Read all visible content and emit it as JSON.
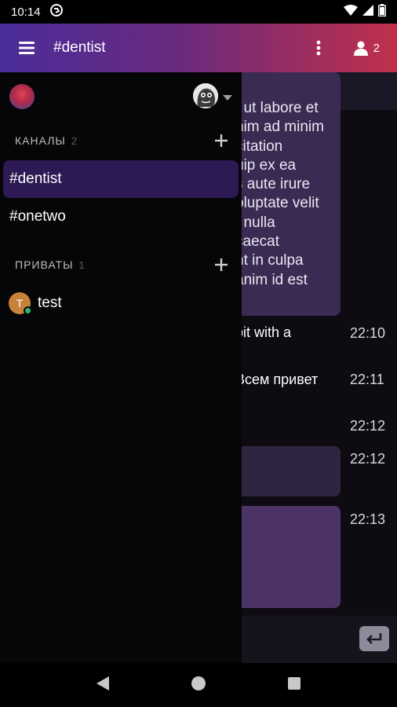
{
  "status_bar": {
    "time": "10:14"
  },
  "header": {
    "title": "#dentist",
    "user_count": "2"
  },
  "drawer": {
    "channels": {
      "label": "КАНАЛЫ",
      "count": "2",
      "items": [
        "#dentist",
        "#onetwo"
      ]
    },
    "privates": {
      "label": "ПРИВАТЫ",
      "count": "1",
      "items": [
        {
          "initial": "T",
          "name": "test"
        }
      ]
    }
  },
  "chat": {
    "lorem_lines": "t ut labore et\nnim ad minim\ncitation\nuip ex ea\ns aute irure\noluptate velit\nt nulla\ncaecat\nnt in culpa\nanim id est",
    "messages": [
      {
        "text": "bit with a",
        "time": "22:10"
      },
      {
        "text": "Всем привет",
        "time": "22:11"
      },
      {
        "text": "",
        "time": "22:12"
      },
      {
        "text": "",
        "time": "22:12"
      },
      {
        "text": "",
        "time": "22:13"
      }
    ]
  }
}
